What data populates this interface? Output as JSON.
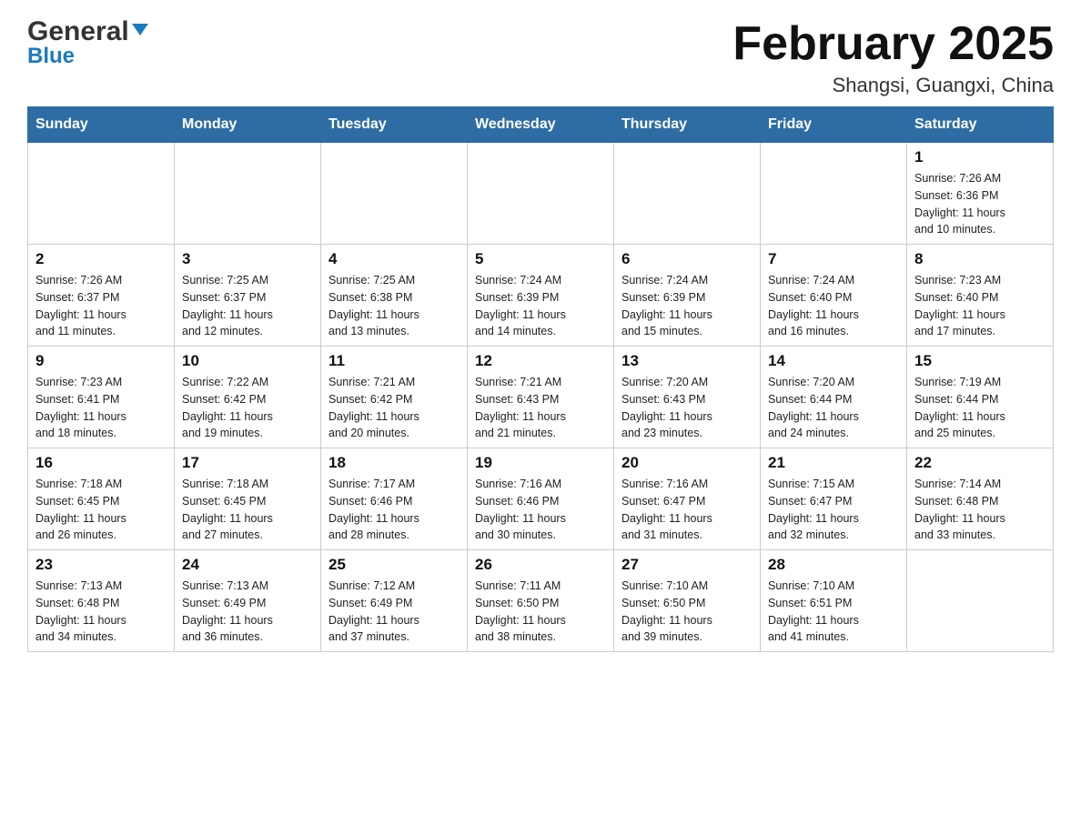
{
  "logo": {
    "general": "General",
    "blue": "Blue"
  },
  "header": {
    "title": "February 2025",
    "location": "Shangsi, Guangxi, China"
  },
  "weekdays": [
    "Sunday",
    "Monday",
    "Tuesday",
    "Wednesday",
    "Thursday",
    "Friday",
    "Saturday"
  ],
  "weeks": [
    [
      {
        "day": "",
        "info": ""
      },
      {
        "day": "",
        "info": ""
      },
      {
        "day": "",
        "info": ""
      },
      {
        "day": "",
        "info": ""
      },
      {
        "day": "",
        "info": ""
      },
      {
        "day": "",
        "info": ""
      },
      {
        "day": "1",
        "info": "Sunrise: 7:26 AM\nSunset: 6:36 PM\nDaylight: 11 hours\nand 10 minutes."
      }
    ],
    [
      {
        "day": "2",
        "info": "Sunrise: 7:26 AM\nSunset: 6:37 PM\nDaylight: 11 hours\nand 11 minutes."
      },
      {
        "day": "3",
        "info": "Sunrise: 7:25 AM\nSunset: 6:37 PM\nDaylight: 11 hours\nand 12 minutes."
      },
      {
        "day": "4",
        "info": "Sunrise: 7:25 AM\nSunset: 6:38 PM\nDaylight: 11 hours\nand 13 minutes."
      },
      {
        "day": "5",
        "info": "Sunrise: 7:24 AM\nSunset: 6:39 PM\nDaylight: 11 hours\nand 14 minutes."
      },
      {
        "day": "6",
        "info": "Sunrise: 7:24 AM\nSunset: 6:39 PM\nDaylight: 11 hours\nand 15 minutes."
      },
      {
        "day": "7",
        "info": "Sunrise: 7:24 AM\nSunset: 6:40 PM\nDaylight: 11 hours\nand 16 minutes."
      },
      {
        "day": "8",
        "info": "Sunrise: 7:23 AM\nSunset: 6:40 PM\nDaylight: 11 hours\nand 17 minutes."
      }
    ],
    [
      {
        "day": "9",
        "info": "Sunrise: 7:23 AM\nSunset: 6:41 PM\nDaylight: 11 hours\nand 18 minutes."
      },
      {
        "day": "10",
        "info": "Sunrise: 7:22 AM\nSunset: 6:42 PM\nDaylight: 11 hours\nand 19 minutes."
      },
      {
        "day": "11",
        "info": "Sunrise: 7:21 AM\nSunset: 6:42 PM\nDaylight: 11 hours\nand 20 minutes."
      },
      {
        "day": "12",
        "info": "Sunrise: 7:21 AM\nSunset: 6:43 PM\nDaylight: 11 hours\nand 21 minutes."
      },
      {
        "day": "13",
        "info": "Sunrise: 7:20 AM\nSunset: 6:43 PM\nDaylight: 11 hours\nand 23 minutes."
      },
      {
        "day": "14",
        "info": "Sunrise: 7:20 AM\nSunset: 6:44 PM\nDaylight: 11 hours\nand 24 minutes."
      },
      {
        "day": "15",
        "info": "Sunrise: 7:19 AM\nSunset: 6:44 PM\nDaylight: 11 hours\nand 25 minutes."
      }
    ],
    [
      {
        "day": "16",
        "info": "Sunrise: 7:18 AM\nSunset: 6:45 PM\nDaylight: 11 hours\nand 26 minutes."
      },
      {
        "day": "17",
        "info": "Sunrise: 7:18 AM\nSunset: 6:45 PM\nDaylight: 11 hours\nand 27 minutes."
      },
      {
        "day": "18",
        "info": "Sunrise: 7:17 AM\nSunset: 6:46 PM\nDaylight: 11 hours\nand 28 minutes."
      },
      {
        "day": "19",
        "info": "Sunrise: 7:16 AM\nSunset: 6:46 PM\nDaylight: 11 hours\nand 30 minutes."
      },
      {
        "day": "20",
        "info": "Sunrise: 7:16 AM\nSunset: 6:47 PM\nDaylight: 11 hours\nand 31 minutes."
      },
      {
        "day": "21",
        "info": "Sunrise: 7:15 AM\nSunset: 6:47 PM\nDaylight: 11 hours\nand 32 minutes."
      },
      {
        "day": "22",
        "info": "Sunrise: 7:14 AM\nSunset: 6:48 PM\nDaylight: 11 hours\nand 33 minutes."
      }
    ],
    [
      {
        "day": "23",
        "info": "Sunrise: 7:13 AM\nSunset: 6:48 PM\nDaylight: 11 hours\nand 34 minutes."
      },
      {
        "day": "24",
        "info": "Sunrise: 7:13 AM\nSunset: 6:49 PM\nDaylight: 11 hours\nand 36 minutes."
      },
      {
        "day": "25",
        "info": "Sunrise: 7:12 AM\nSunset: 6:49 PM\nDaylight: 11 hours\nand 37 minutes."
      },
      {
        "day": "26",
        "info": "Sunrise: 7:11 AM\nSunset: 6:50 PM\nDaylight: 11 hours\nand 38 minutes."
      },
      {
        "day": "27",
        "info": "Sunrise: 7:10 AM\nSunset: 6:50 PM\nDaylight: 11 hours\nand 39 minutes."
      },
      {
        "day": "28",
        "info": "Sunrise: 7:10 AM\nSunset: 6:51 PM\nDaylight: 11 hours\nand 41 minutes."
      },
      {
        "day": "",
        "info": ""
      }
    ]
  ]
}
